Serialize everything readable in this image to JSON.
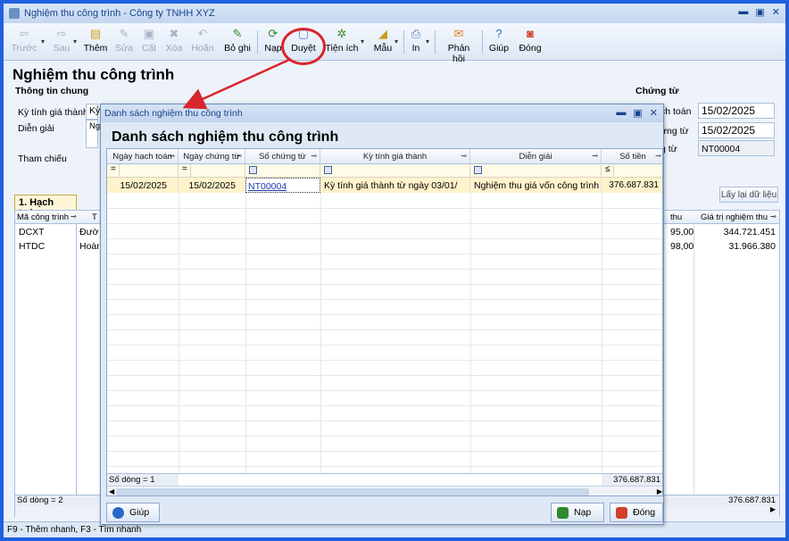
{
  "window": {
    "title": "Nghiệm thu công trình - Công ty TNHH XYZ"
  },
  "toolbar": {
    "items": [
      {
        "label": "Trước",
        "icon": "arrow-left-icon",
        "enabled": false
      },
      {
        "label": "Sau",
        "icon": "arrow-right-icon",
        "enabled": false
      },
      {
        "label": "Thêm",
        "icon": "add-document-icon",
        "enabled": true
      },
      {
        "label": "Sửa",
        "icon": "edit-icon",
        "enabled": false
      },
      {
        "label": "Cất",
        "icon": "save-icon",
        "enabled": false
      },
      {
        "label": "Xóa",
        "icon": "delete-icon",
        "enabled": false
      },
      {
        "label": "Hoãn",
        "icon": "undo-icon",
        "enabled": false
      },
      {
        "label": "Bỏ ghi",
        "icon": "unpost-icon",
        "enabled": true
      },
      {
        "label": "Nạp",
        "icon": "refresh-icon",
        "enabled": true
      },
      {
        "label": "Duyệt",
        "icon": "browse-icon",
        "enabled": true
      },
      {
        "label": "Tiện ích",
        "icon": "utilities-icon",
        "enabled": true
      },
      {
        "label": "Mẫu",
        "icon": "template-icon",
        "enabled": true
      },
      {
        "label": "In",
        "icon": "print-icon",
        "enabled": true
      },
      {
        "label": "Phản hồi",
        "icon": "feedback-icon",
        "enabled": true
      },
      {
        "label": "Giúp",
        "icon": "help-icon",
        "enabled": true
      },
      {
        "label": "Đóng",
        "icon": "close-icon",
        "enabled": true
      }
    ]
  },
  "page": {
    "title": "Nghiệm thu công trình"
  },
  "general": {
    "group_label": "Thông tin chung",
    "period_label": "Kỳ tính giá thành",
    "period_value": "Kỳ",
    "desc_label": "Diễn giải",
    "desc_value": "Ng",
    "ref_label": "Tham chiếu"
  },
  "voucher": {
    "group_label": "Chứng từ",
    "posting_date_label": "ch toán",
    "posting_date": "15/02/2025",
    "voucher_date_label": "ứng từ",
    "voucher_date": "15/02/2025",
    "voucher_no_label": "g từ",
    "voucher_no": "NT00004"
  },
  "detail": {
    "tab_label": "1. Hạch toán",
    "reload_button": "Lấy lại dữ liệu",
    "col_code": "Mã công trình",
    "col_t": "T",
    "col_pct": "thu",
    "col_value": "Giá trị nghiệm thu",
    "rows": [
      {
        "code": "DCXT",
        "name": "Đườn",
        "pct": "95,00",
        "value": "344.721.451"
      },
      {
        "code": "HTDC",
        "name": "Hoàn",
        "pct": "98,00",
        "value": "31.966.380"
      }
    ],
    "row_count": "Số dòng = 2",
    "total": "376.687.831"
  },
  "statusbar": {
    "text": "F9 - Thêm nhanh, F3 - Tìm nhanh"
  },
  "dialog": {
    "title": "Danh sách nghiệm thu công trình",
    "heading": "Danh sách nghiệm thu công trình",
    "columns": [
      "Ngày hạch toán",
      "Ngày chứng từ",
      "Số chứng từ",
      "Kỳ tính giá thành",
      "Diễn giải",
      "Số tiền"
    ],
    "filters": [
      "=",
      "=",
      "",
      "",
      "",
      "≤"
    ],
    "rows": [
      {
        "posting_date": "15/02/2025",
        "voucher_date": "15/02/2025",
        "voucher_no": "NT00004",
        "period": "Kỳ tính giá thành từ ngày 03/01/",
        "description": "Nghiệm thu giá vốn công trình",
        "amount": "376.687.831"
      }
    ],
    "row_count": "Số dòng = 1",
    "total": "376.687.831",
    "help_button": "Giúp",
    "load_button": "Nạp",
    "close_button": "Đóng"
  }
}
